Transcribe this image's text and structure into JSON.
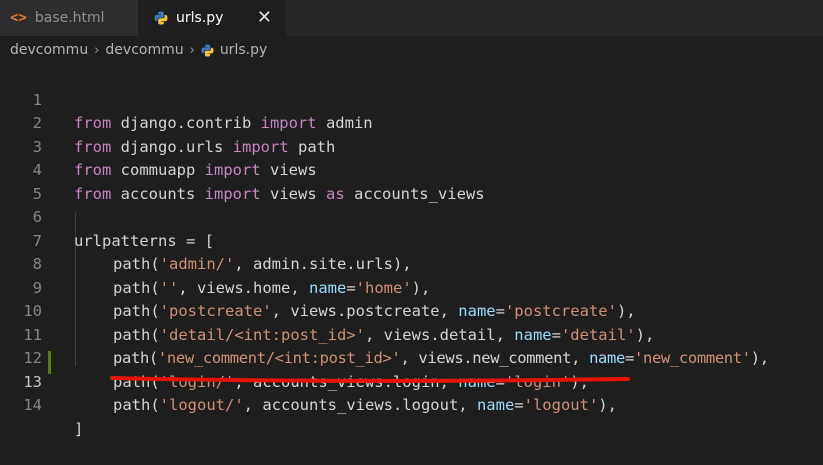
{
  "tabs": [
    {
      "label": "base.html",
      "icon": "html-icon",
      "active": false
    },
    {
      "label": "urls.py",
      "icon": "python-icon",
      "active": true,
      "close": "✕"
    }
  ],
  "breadcrumb": [
    "devcommu",
    "devcommu",
    "urls.py"
  ],
  "breadcrumb_separator": "›",
  "line_numbers": [
    "1",
    "2",
    "3",
    "4",
    "5",
    "6",
    "7",
    "8",
    "9",
    "10",
    "11",
    "12",
    "13",
    "14"
  ],
  "code": {
    "l1": [
      "from",
      " django.contrib ",
      "import",
      " admin"
    ],
    "l2": [
      "from",
      " django.urls ",
      "import",
      " path"
    ],
    "l3": [
      "from",
      " commuapp ",
      "import",
      " views"
    ],
    "l4": [
      "from",
      " accounts ",
      "import",
      " views ",
      "as",
      " accounts_views"
    ],
    "l6": "urlpatterns = [",
    "l7": [
      "path(",
      "'admin/'",
      ", admin.site.urls),"
    ],
    "l8": [
      "path(",
      "''",
      ", views.home, ",
      "name",
      "=",
      "'home'",
      "),"
    ],
    "l9": [
      "path(",
      "'postcreate'",
      ", views.postcreate, ",
      "name",
      "=",
      "'postcreate'",
      "),"
    ],
    "l10": [
      "path(",
      "'detail/<int:post_id>'",
      ", views.detail, ",
      "name",
      "=",
      "'detail'",
      "),"
    ],
    "l11": [
      "path(",
      "'new_comment/<int:post_id>'",
      ", views.new_comment, ",
      "name",
      "=",
      "'new_comment'",
      "),"
    ],
    "l12": [
      "path(",
      "'login/'",
      ", accounts_views.login, ",
      "name",
      "=",
      "'login'",
      "),"
    ],
    "l13": [
      "path(",
      "'logout/'",
      ", accounts_views.logout, ",
      "name",
      "=",
      "'logout'",
      "),"
    ],
    "l14": "]"
  },
  "colors": {
    "keyword": "#c586c0",
    "string": "#ce9178",
    "parameter": "#9cdcfe",
    "text": "#d4d4d4",
    "annotation": "#e51400"
  }
}
